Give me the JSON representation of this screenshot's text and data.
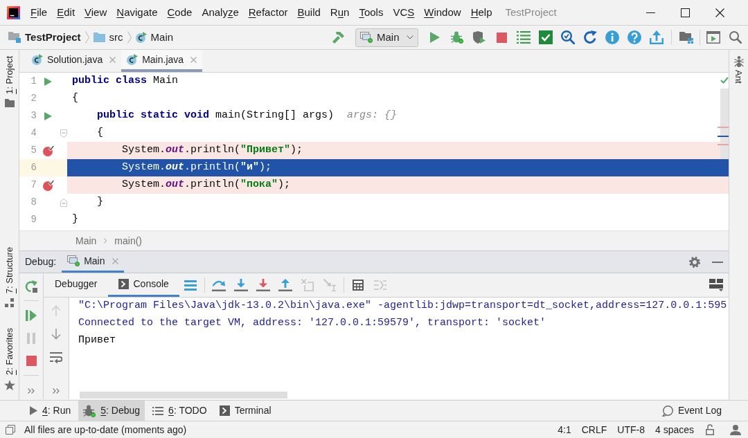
{
  "menu_bar": {
    "items": [
      {
        "mnemonic": "F",
        "after": "ile"
      },
      {
        "mnemonic": "E",
        "after": "dit"
      },
      {
        "mnemonic": "V",
        "after": "iew"
      },
      {
        "mnemonic": "N",
        "after": "avigate"
      },
      {
        "mnemonic": "C",
        "after": "ode"
      },
      {
        "before": "Analy",
        "mnemonic": "z",
        "after": "e"
      },
      {
        "mnemonic": "R",
        "after": "efactor"
      },
      {
        "mnemonic": "B",
        "after": "uild"
      },
      {
        "before": "R",
        "mnemonic": "u",
        "after": "n"
      },
      {
        "mnemonic": "T",
        "after": "ools"
      },
      {
        "before": "VC",
        "mnemonic": "S"
      },
      {
        "mnemonic": "W",
        "after": "indow"
      },
      {
        "mnemonic": "H",
        "after": "elp"
      }
    ],
    "window_title": "TestProject"
  },
  "navigation_bar": {
    "breadcrumbs": [
      {
        "kind": "project",
        "label": "TestProject"
      },
      {
        "kind": "folder",
        "label": "src"
      },
      {
        "kind": "class",
        "label": "Main"
      }
    ],
    "run_configuration": "Main"
  },
  "left_tool_stripe": {
    "top": [
      {
        "kind": "project",
        "mnemonic": "1",
        "after": ": Project"
      }
    ],
    "bottom": [
      {
        "kind": "structure",
        "mnemonic": "7",
        "after": ": Structure"
      },
      {
        "kind": "favorites",
        "mnemonic": "2",
        "after": ": Favorites"
      }
    ]
  },
  "right_tool_stripe": [
    {
      "kind": "ant",
      "label": "Ant"
    }
  ],
  "editor_tabs": [
    {
      "label": "Solution.java",
      "selected": false
    },
    {
      "label": "Main.java",
      "selected": true
    }
  ],
  "editor": {
    "lines": [
      {
        "number": "1",
        "kind": "runnable",
        "tokens": [
          {
            "kind": "keyword",
            "text": "public class"
          },
          {
            "kind": "plain",
            "text": " Main"
          }
        ]
      },
      {
        "number": "2",
        "kind": "plain",
        "tokens": [
          {
            "kind": "plain",
            "text": "{"
          }
        ],
        "children": [
          {
            "number": "3",
            "kind": "runnable",
            "tokens": [
              {
                "kind": "keyword",
                "text": "public static void"
              },
              {
                "kind": "plain",
                "text": " main(String[] args)"
              },
              {
                "kind": "hint",
                "text": "args: {}"
              }
            ]
          },
          {
            "number": "4",
            "kind": "fold-start",
            "tokens": [
              {
                "kind": "plain",
                "text": "{"
              }
            ],
            "children": [
              {
                "number": "5",
                "kind": "breakpoint",
                "tokens": [
                  {
                    "kind": "plain",
                    "text": "System."
                  },
                  {
                    "kind": "field",
                    "text": "out"
                  },
                  {
                    "kind": "plain",
                    "text": ".println("
                  },
                  {
                    "kind": "string",
                    "text": "\"Привет\""
                  },
                  {
                    "kind": "plain",
                    "text": ");"
                  }
                ]
              },
              {
                "number": "6",
                "kind": "execution",
                "tokens": [
                  {
                    "kind": "plain",
                    "text": "System."
                  },
                  {
                    "kind": "field",
                    "text": "out"
                  },
                  {
                    "kind": "plain",
                    "text": ".println("
                  },
                  {
                    "kind": "string",
                    "text": "\"и\""
                  },
                  {
                    "kind": "plain",
                    "text": ");"
                  }
                ]
              },
              {
                "number": "7",
                "kind": "breakpoint",
                "tokens": [
                  {
                    "kind": "plain",
                    "text": "System."
                  },
                  {
                    "kind": "field",
                    "text": "out"
                  },
                  {
                    "kind": "plain",
                    "text": ".println("
                  },
                  {
                    "kind": "string",
                    "text": "\"пока\""
                  },
                  {
                    "kind": "plain",
                    "text": ");"
                  }
                ]
              }
            ]
          },
          {
            "number": "8",
            "kind": "fold-end",
            "tokens": [
              {
                "kind": "plain",
                "text": "}"
              }
            ]
          }
        ]
      },
      {
        "number": "9",
        "kind": "plain",
        "tokens": [
          {
            "kind": "plain",
            "text": "}"
          }
        ]
      }
    ]
  },
  "editor_breadcrumbs": [
    "Main",
    "main()"
  ],
  "debug_panel": {
    "title": "Debug:",
    "session_tabs": [
      {
        "label": "Main",
        "selected": true
      }
    ],
    "side_actions": [
      [
        {
          "kind": "rerun",
          "disabled": false
        }
      ],
      [
        {
          "kind": "resume",
          "disabled": false
        },
        {
          "kind": "pause",
          "disabled": true
        },
        {
          "kind": "stop",
          "disabled": false
        }
      ]
    ],
    "view_tabs": [
      {
        "kind": "debugger",
        "label": "Debugger",
        "selected": false
      },
      {
        "kind": "console",
        "label": "Console",
        "selected": true
      }
    ],
    "toolbar": [
      [
        {
          "kind": "show-execution-point",
          "disabled": false
        }
      ],
      [
        {
          "kind": "step-over",
          "disabled": false
        },
        {
          "kind": "step-into",
          "disabled": false
        },
        {
          "kind": "force-step-into",
          "disabled": false
        },
        {
          "kind": "step-out",
          "disabled": false
        },
        {
          "kind": "drop-frame",
          "disabled": true
        },
        {
          "kind": "run-to-cursor",
          "disabled": true
        }
      ],
      [
        {
          "kind": "evaluate",
          "disabled": false
        },
        {
          "kind": "trace",
          "disabled": true
        }
      ]
    ],
    "console_actions": [
      {
        "kind": "up",
        "disabled": true
      },
      {
        "kind": "down",
        "disabled": false
      },
      {
        "kind": "soft-wrap",
        "disabled": false
      }
    ],
    "console_lines": [
      {
        "kind": "system",
        "text": "\"C:\\Program Files\\Java\\jdk-13.0.2\\bin\\java.exe\" -agentlib:jdwp=transport=dt_socket,address=127.0.0.1:595"
      },
      {
        "kind": "system",
        "text": "Connected to the target VM, address: '127.0.0.1:59579', transport: 'socket'"
      },
      {
        "kind": "output",
        "text": "Привет"
      }
    ]
  },
  "bottom_tool_bar": {
    "items": [
      {
        "kind": "run",
        "mnemonic": "4",
        "after": ": Run",
        "selected": false
      },
      {
        "kind": "debug",
        "mnemonic": "5",
        "after": ": Debug",
        "selected": true
      },
      {
        "kind": "todo",
        "mnemonic": "6",
        "after": ": TODO",
        "selected": false
      },
      {
        "kind": "terminal",
        "label": "Terminal",
        "selected": false
      }
    ],
    "event_log": "Event Log"
  },
  "status_bar": {
    "message": "All files are up-to-date (moments ago)",
    "indicators": [
      "4:1",
      "CRLF",
      "UTF-8",
      "4 spaces"
    ]
  }
}
